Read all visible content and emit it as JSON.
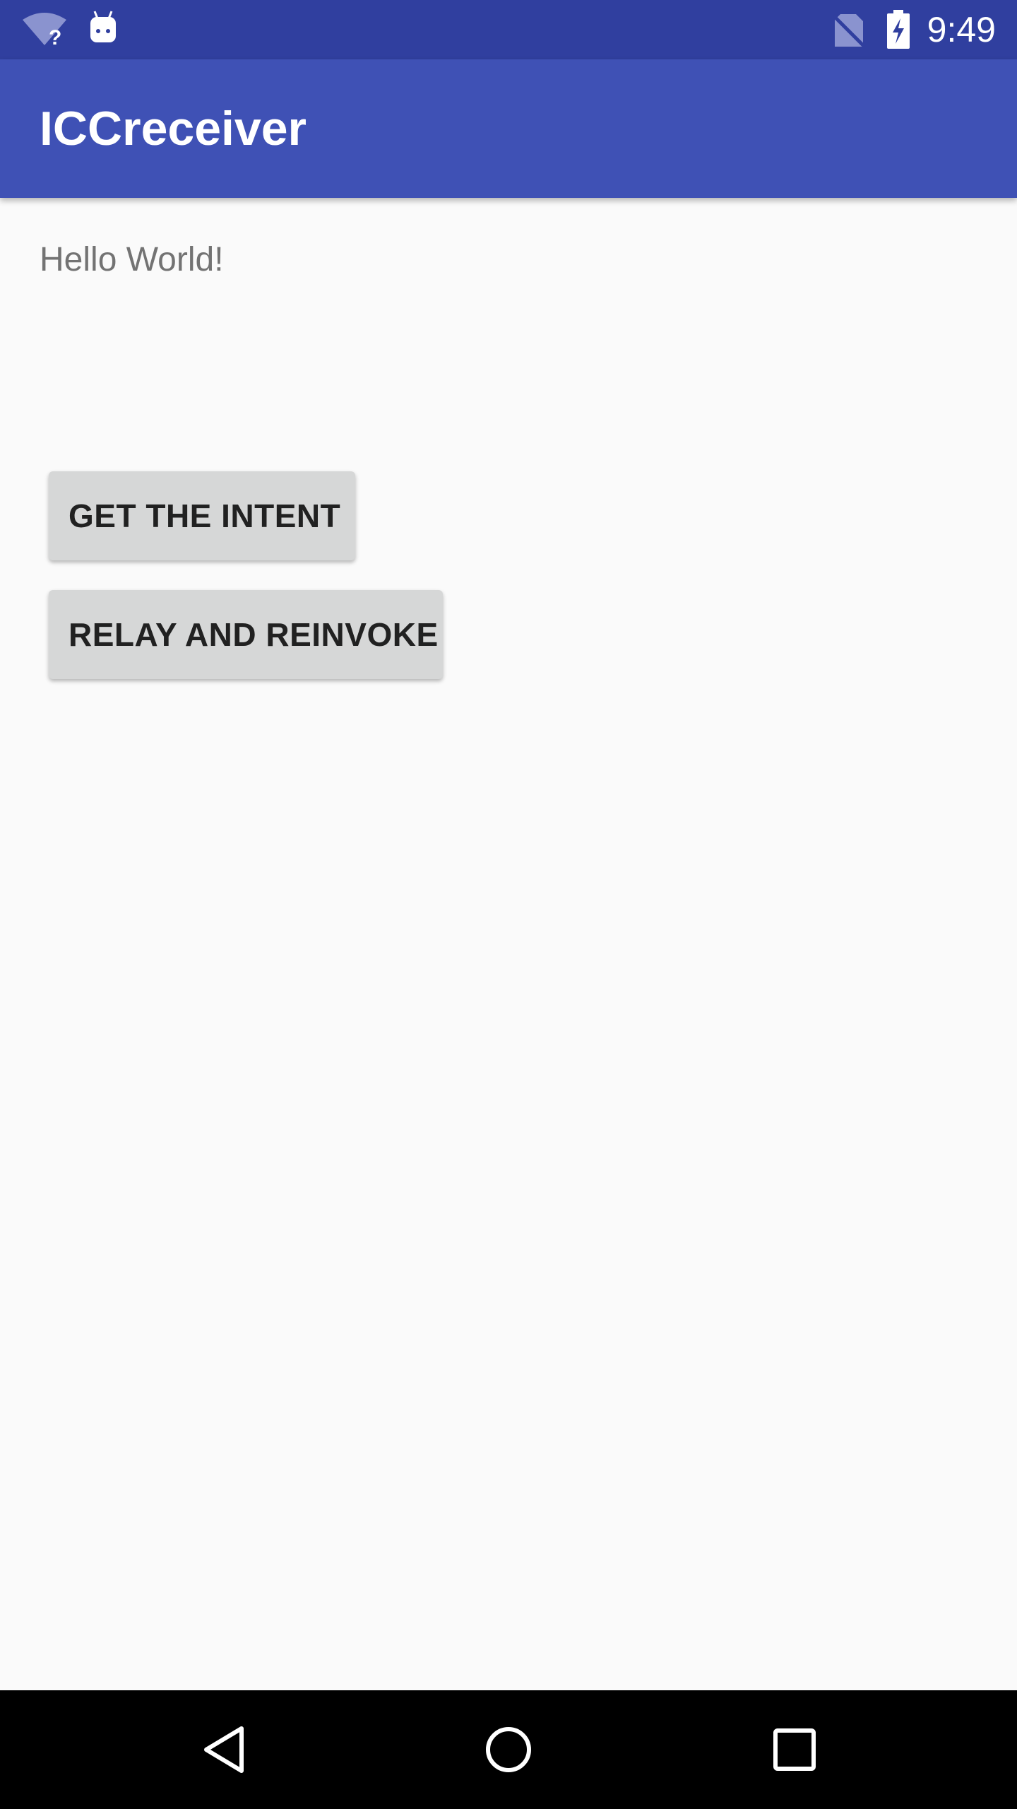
{
  "status_bar": {
    "time": "9:49",
    "icons": [
      "wifi-unknown-icon",
      "android-notification-icon",
      "no-sim-icon",
      "battery-charging-icon"
    ]
  },
  "app_bar": {
    "title": "ICCreceiver",
    "color": "#3f51b5",
    "status_color": "#303f9f"
  },
  "content": {
    "hello_text": "Hello World!",
    "buttons": [
      {
        "label": "GET THE INTENT"
      },
      {
        "label": "RELAY AND REINVOKE"
      }
    ]
  },
  "nav_bar": {
    "icons": [
      "back-icon",
      "home-icon",
      "recents-icon"
    ]
  }
}
